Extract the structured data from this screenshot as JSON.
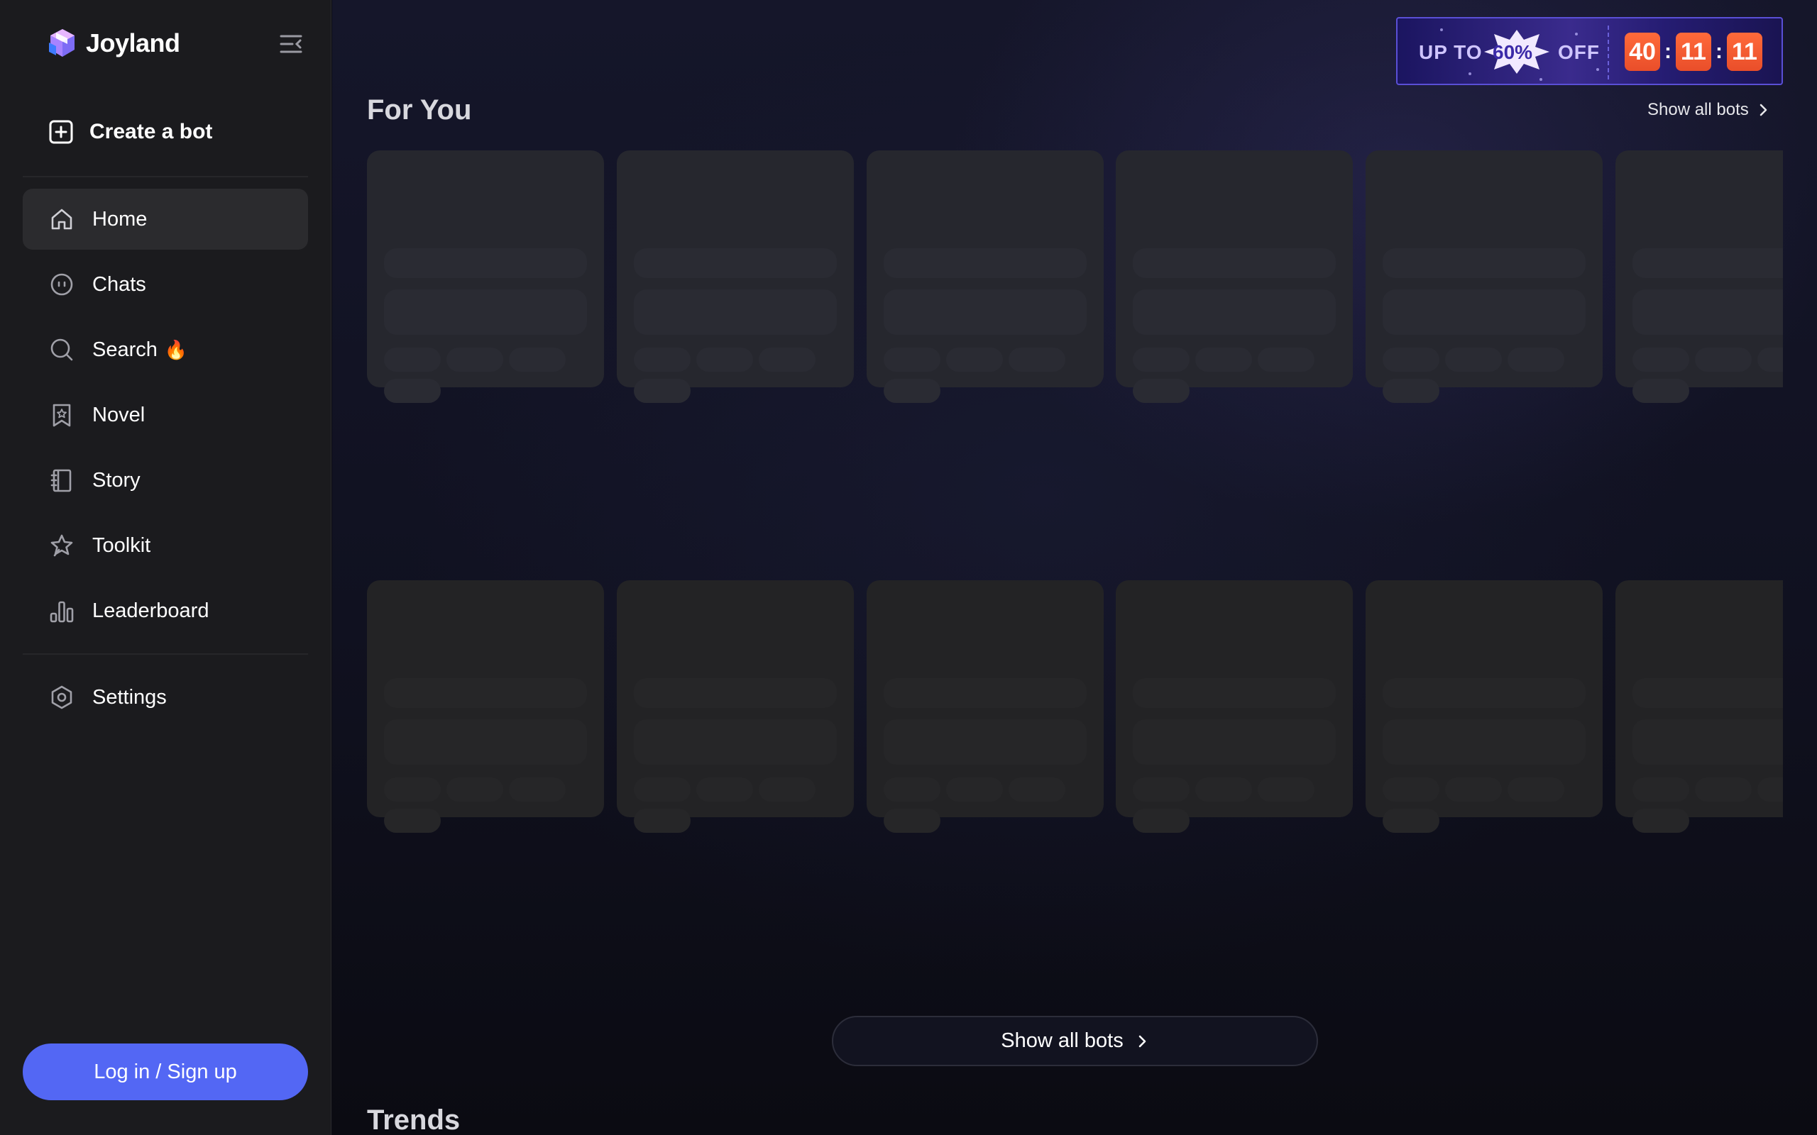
{
  "brand": {
    "name": "Joyland"
  },
  "sidebar": {
    "create_bot_label": "Create a bot",
    "items": [
      {
        "key": "home",
        "label": "Home",
        "icon": "home-icon",
        "active": true
      },
      {
        "key": "chats",
        "label": "Chats",
        "icon": "chat-icon"
      },
      {
        "key": "search",
        "label": "Search",
        "icon": "search-icon",
        "emoji": "🔥"
      },
      {
        "key": "novel",
        "label": "Novel",
        "icon": "bookmark-star-icon"
      },
      {
        "key": "story",
        "label": "Story",
        "icon": "book-icon"
      },
      {
        "key": "toolkit",
        "label": "Toolkit",
        "icon": "star-badge-icon"
      },
      {
        "key": "leaderboard",
        "label": "Leaderboard",
        "icon": "bar-chart-icon"
      }
    ],
    "settings_label": "Settings",
    "login_label": "Log in / Sign up"
  },
  "promo": {
    "up_to": "UP TO",
    "percent": "60%",
    "off": "OFF",
    "timer": [
      "40",
      "11",
      "11"
    ],
    "colon": ":"
  },
  "main": {
    "for_you_title": "For You",
    "show_all_link": "Show all bots",
    "show_all_button": "Show all bots",
    "trends_title": "Trends"
  },
  "colors": {
    "accent": "#5367f4",
    "sidebar_bg": "#1b1b1e",
    "timer_orange": "#ff6a3a"
  }
}
